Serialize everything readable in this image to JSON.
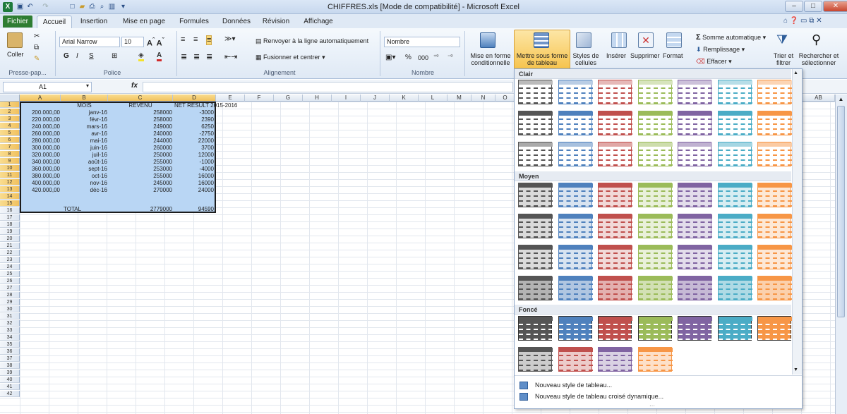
{
  "window": {
    "title": "CHIFFRES.xls [Mode de compatibilité] - Microsoft Excel"
  },
  "tabs": [
    "Fichier",
    "Accueil",
    "Insertion",
    "Mise en page",
    "Formules",
    "Données",
    "Révision",
    "Affichage"
  ],
  "ribbon": {
    "paste": "Coller",
    "font_name": "Arial Narrow",
    "font_size": "10",
    "bold": "G",
    "italic": "I",
    "underline": "S",
    "wrap": "Renvoyer à la ligne automatiquement",
    "merge": "Fusionner et centrer",
    "number_format": "Nombre",
    "percent": "%",
    "thousands": "000",
    "cond_format_1": "Mise en forme",
    "cond_format_2": "conditionnelle",
    "table_style_1": "Mettre sous forme",
    "table_style_2": "de tableau",
    "cell_style_1": "Styles de",
    "cell_style_2": "cellules",
    "insert": "Insérer",
    "delete": "Supprimer",
    "format": "Format",
    "autosum": "Somme automatique",
    "fill": "Remplissage",
    "clear": "Effacer",
    "sort_1": "Trier et",
    "sort_2": "filtrer",
    "find_1": "Rechercher et",
    "find_2": "sélectionner",
    "groups": [
      "Presse-pap...",
      "Police",
      "Alignement",
      "Nombre"
    ]
  },
  "formula_bar": {
    "name_box": "A1",
    "fx": "fx",
    "value": ""
  },
  "columns": [
    "A",
    "B",
    "C",
    "D",
    "E",
    "F",
    "G",
    "H",
    "I",
    "J",
    "K",
    "L",
    "M",
    "N",
    "O",
    "AB"
  ],
  "sheet": {
    "header": {
      "b": "MOIS",
      "c": "REVENU",
      "d": "NET RESULT 2015-2016"
    },
    "rows": [
      {
        "a": "200.000,00",
        "b": "janv-16",
        "c": "258000",
        "d": "-3000"
      },
      {
        "a": "220.000,00",
        "b": "févr-16",
        "c": "258000",
        "d": "2390"
      },
      {
        "a": "240.000,00",
        "b": "mars-16",
        "c": "249000",
        "d": "6250"
      },
      {
        "a": "260.000,00",
        "b": "avr-16",
        "c": "240000",
        "d": "-2750"
      },
      {
        "a": "280.000,00",
        "b": "mai-16",
        "c": "244000",
        "d": "22000"
      },
      {
        "a": "300.000,00",
        "b": "juin-16",
        "c": "260000",
        "d": "3700"
      },
      {
        "a": "320.000,00",
        "b": "juil-16",
        "c": "250000",
        "d": "12000"
      },
      {
        "a": "340.000,00",
        "b": "août-16",
        "c": "255000",
        "d": "-1000"
      },
      {
        "a": "360.000,00",
        "b": "sept-16",
        "c": "253000",
        "d": "-4000"
      },
      {
        "a": "380.000,00",
        "b": "oct-16",
        "c": "255000",
        "d": "16000"
      },
      {
        "a": "400.000,00",
        "b": "nov-16",
        "c": "245000",
        "d": "16000"
      },
      {
        "a": "420.000,00",
        "b": "déc-16",
        "c": "270000",
        "d": "24000"
      }
    ],
    "total": {
      "b": "TOTAL",
      "c": "2779000",
      "d": "94590"
    }
  },
  "dropdown": {
    "sections": [
      "Clair",
      "Moyen",
      "Foncé"
    ],
    "new_table_style": "Nouveau style de tableau...",
    "new_pivot_style": "Nouveau style de tableau croisé dynamique...",
    "colors": [
      "#555555",
      "#4f81bd",
      "#c0504d",
      "#9bbb59",
      "#8064a2",
      "#4bacc6",
      "#f79646"
    ]
  }
}
